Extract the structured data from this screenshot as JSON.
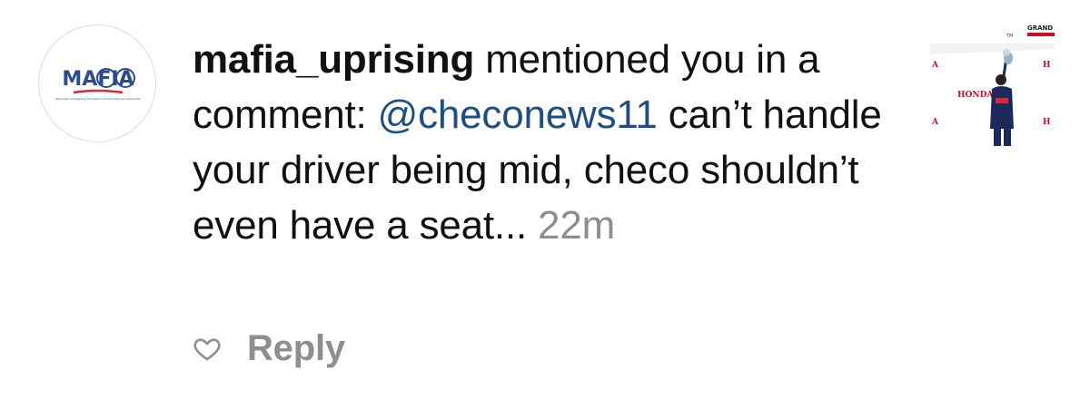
{
  "avatar": {
    "logo_text": "MAFIA",
    "logo_subtext": "Mercedes Autoleading Foundation of International Automobile"
  },
  "notification": {
    "username": "mafia_uprising",
    "action_text": "mentioned you in a comment:",
    "mention": "@checonews11",
    "comment_text": "can’t handle your driver being mid, checo shouldn’t even have a seat...",
    "timestamp": "22m"
  },
  "post_thumbnail": {
    "banner_text": "GRAND PRI",
    "tm_mark": "TM",
    "sponsor_text": "HONDA"
  },
  "actions": {
    "like_icon": "heart-outline-icon",
    "reply_label": "Reply"
  },
  "colors": {
    "mention": "#1e4f80",
    "muted": "#8e8e8e",
    "logo_blue": "#2b4b8c",
    "logo_red": "#d42a35"
  }
}
